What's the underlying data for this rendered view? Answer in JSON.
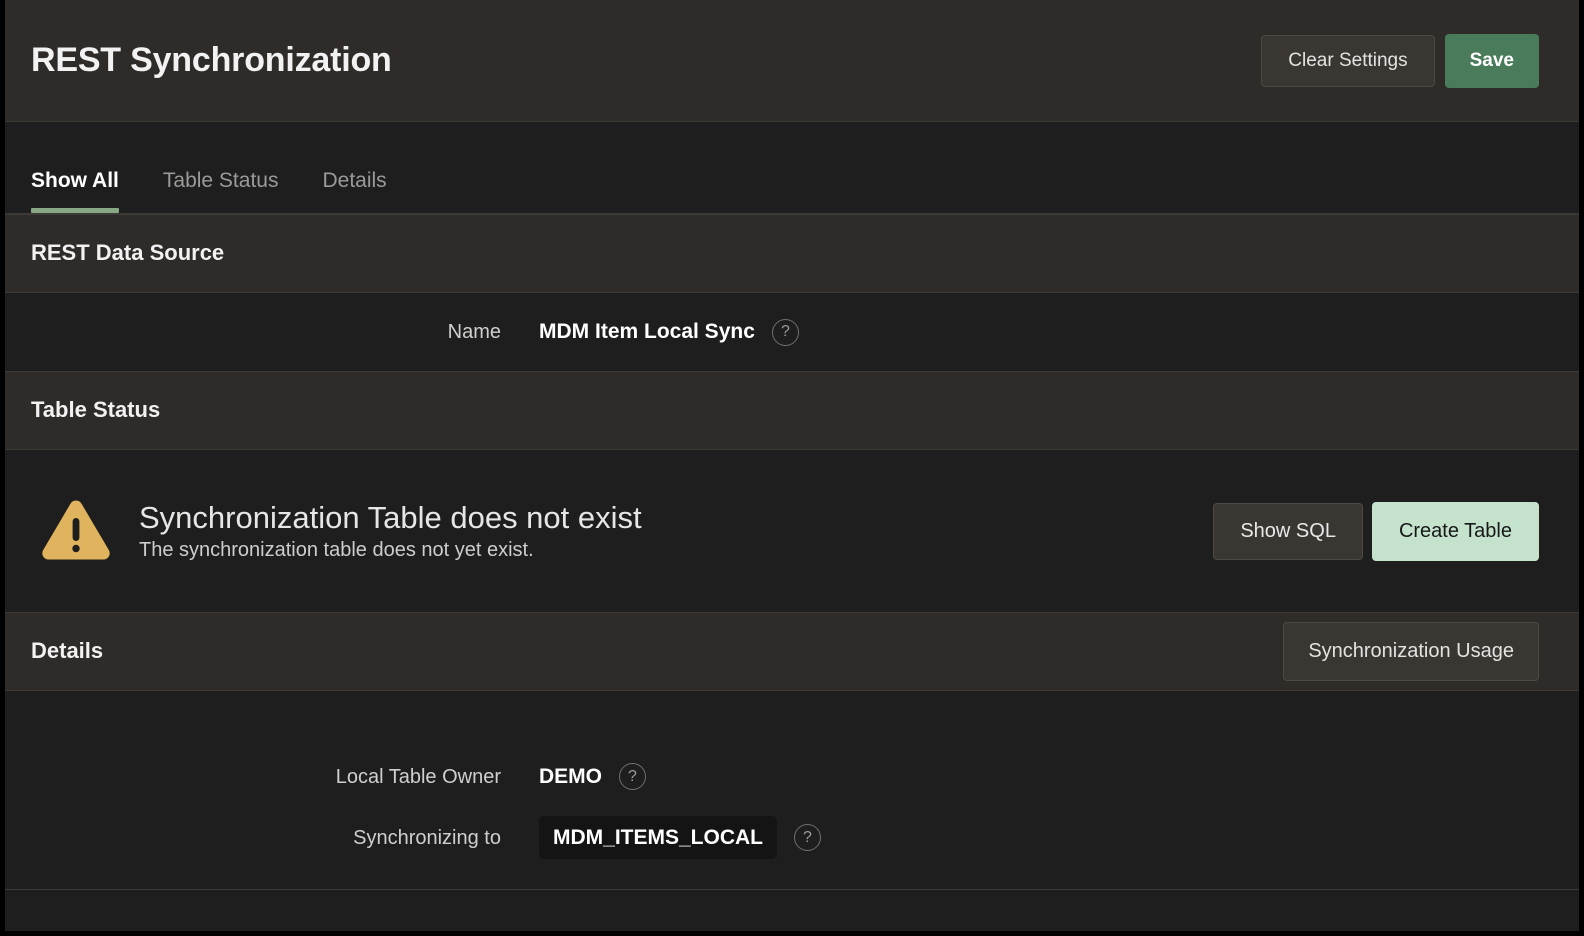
{
  "header": {
    "title": "REST Synchronization",
    "clear_settings_label": "Clear Settings",
    "save_label": "Save"
  },
  "tabs": [
    {
      "label": "Show All",
      "active": true
    },
    {
      "label": "Table Status",
      "active": false
    },
    {
      "label": "Details",
      "active": false
    }
  ],
  "rest_data_source": {
    "heading": "REST Data Source",
    "name_label": "Name",
    "name_value": "MDM Item Local Sync",
    "help_glyph": "?"
  },
  "table_status": {
    "heading": "Table Status",
    "alert_icon": "warning-triangle-icon",
    "alert_title": "Synchronization Table does not exist",
    "alert_subtitle": "The synchronization table does not yet exist.",
    "show_sql_label": "Show SQL",
    "create_table_label": "Create Table"
  },
  "details": {
    "heading": "Details",
    "usage_button_label": "Synchronization Usage",
    "local_table_owner_label": "Local Table Owner",
    "local_table_owner_value": "DEMO",
    "synchronizing_to_label": "Synchronizing to",
    "synchronizing_to_value": "MDM_ITEMS_LOCAL",
    "help_glyph": "?"
  },
  "colors": {
    "page_background": "#1e1e1e",
    "band_background": "#2e2b28",
    "accent_green": "#87a882",
    "save_green": "#4a7c5c",
    "mint_green": "#c5e3cc",
    "warning_amber": "#e0b45f",
    "text_primary": "#f2f2f2",
    "text_muted": "#9a9a98"
  }
}
